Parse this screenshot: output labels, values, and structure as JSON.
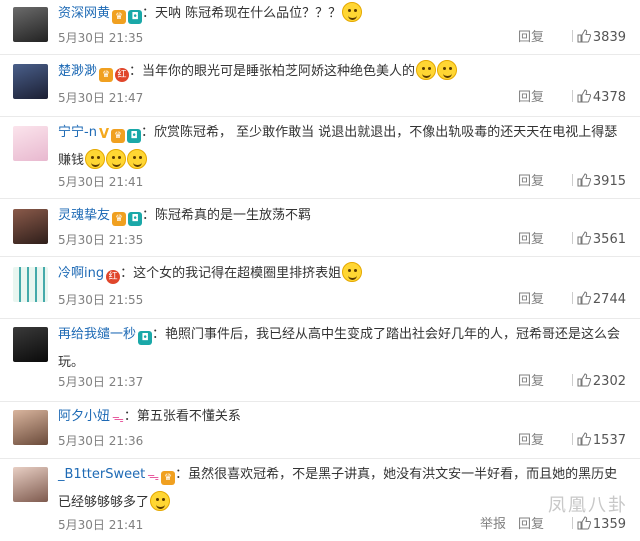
{
  "comments": [
    {
      "user": "资深网黄",
      "text": "天呐 陈冠希现在什么品位？？？",
      "time": "5月30日 21:35",
      "reply": "回复",
      "likes": "3839"
    },
    {
      "user": "楚渺渺",
      "text": "当年你的眼光可是睡张柏芝阿娇这种绝色美人的",
      "time": "5月30日 21:47",
      "reply": "回复",
      "likes": "4378"
    },
    {
      "user": "宁宁-n",
      "text": "欣赏陈冠希， 至少敢作敢当 说退出就退出，不像出轨吸毒的还天天在电视上得瑟 赚钱",
      "time": "5月30日 21:41",
      "reply": "回复",
      "likes": "3915"
    },
    {
      "user": "灵魂挚友",
      "text": "陈冠希真的是一生放荡不羁",
      "time": "5月30日 21:35",
      "reply": "回复",
      "likes": "3561"
    },
    {
      "user": "冷啊ing",
      "text": "这个女的我记得在超模圈里排挤表姐",
      "time": "5月30日 21:55",
      "reply": "回复",
      "likes": "2744"
    },
    {
      "user": "再给我缱一秒",
      "text": "艳照门事件后，我已经从高中生变成了踏出社会好几年的人，冠希哥还是这么会玩。",
      "time": "5月30日 21:37",
      "reply": "回复",
      "likes": "2302"
    },
    {
      "user": "阿夕小妞",
      "text": "第五张看不懂关系",
      "time": "5月30日 21:36",
      "reply": "回复",
      "likes": "1537"
    },
    {
      "user": "_B1tterSweet",
      "text": "虽然很喜欢冠希，不是黑子讲真，她没有洪文安一半好看，而且她的黑历史已经够够够多了",
      "time": "5月30日 21:41",
      "reply": "回复",
      "report": "举报",
      "likes": "1359"
    }
  ],
  "watermark": "凤凰八卦",
  "colors": {
    "name": "#1e6ab5",
    "meta": "#808080",
    "badge_vip": "#f0a020",
    "badge_red": "#e0462b"
  }
}
